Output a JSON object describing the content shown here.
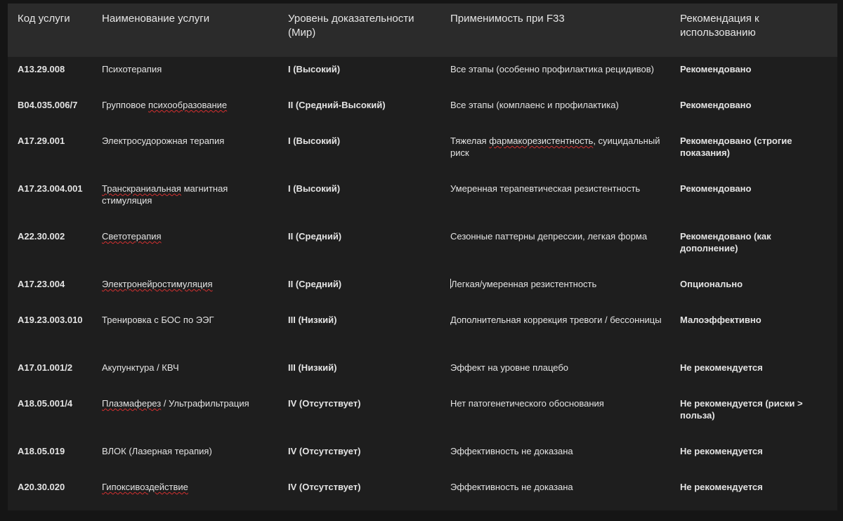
{
  "headers": {
    "code": "Код услуги",
    "name": "Наименование услуги",
    "evidence": "Уровень доказательности (Мир)",
    "applicability": "Применимость при F33",
    "recommendation": "Рекомендация к использованию"
  },
  "rows": [
    {
      "code": "A13.29.008",
      "name_pre": "",
      "name_err": "",
      "name_post": "Психотерапия",
      "evidence": "I (Высокий)",
      "app_pre": "Все этапы (особенно профилактика рецидивов)",
      "app_err": "",
      "app_post": "",
      "rec": "Рекомендовано"
    },
    {
      "code": "B04.035.006/7",
      "name_pre": "Групповое ",
      "name_err": "психообразование",
      "name_post": "",
      "evidence": "II (Средний-Высокий)",
      "app_pre": "Все этапы (комплаенс и профилактика)",
      "app_err": "",
      "app_post": "",
      "rec": "Рекомендовано"
    },
    {
      "code": "A17.29.001",
      "name_pre": "Электросудорожная терапия",
      "name_err": "",
      "name_post": "",
      "evidence": "I (Высокий)",
      "app_pre": "Тяжелая ",
      "app_err": "фармакорезистентность",
      "app_post": ", суицидальный риск",
      "rec": "Рекомендовано (строгие показания)"
    },
    {
      "code": "A17.23.004.001",
      "name_pre": "",
      "name_err": "Транскраниальная",
      "name_post": " магнитная стимуляция",
      "evidence": "I (Высокий)",
      "app_pre": "Умеренная терапевтическая резистентность",
      "app_err": "",
      "app_post": "",
      "rec": "Рекомендовано"
    },
    {
      "code": "A22.30.002",
      "name_pre": "",
      "name_err": "Светотерапия",
      "name_post": "",
      "evidence": "II (Средний)",
      "app_pre": "Сезонные паттерны депрессии, легкая форма",
      "app_err": "",
      "app_post": "",
      "rec": "Рекомендовано (как дополнение)"
    },
    {
      "code": "A17.23.004",
      "name_pre": "",
      "name_err": "Электронейростимуляция",
      "name_post": "",
      "evidence": "II (Средний)",
      "app_pre": "Легкая/умеренная резистентность",
      "app_err": "",
      "app_post": "",
      "rec": "Опционально"
    },
    {
      "code": "A19.23.003.010",
      "name_pre": "Тренировка с БОС по ЭЭГ",
      "name_err": "",
      "name_post": "",
      "evidence": "III (Низкий)",
      "app_pre": "Дополнительная коррекция тревоги / бессонницы",
      "app_err": "",
      "app_post": "",
      "rec": "Малоэффективно"
    },
    {
      "code": "A17.01.001/2",
      "name_pre": "Акупунктура / КВЧ",
      "name_err": "",
      "name_post": "",
      "evidence": "III (Низкий)",
      "app_pre": "Эффект на уровне плацебо",
      "app_err": "",
      "app_post": "",
      "rec": "Не рекомендуется"
    },
    {
      "code": "A18.05.001/4",
      "name_pre": "",
      "name_err": "Плазмаферез",
      "name_post": " / Ультрафильтрация",
      "evidence": "IV (Отсутствует)",
      "app_pre": "Нет патогенетического обоснования",
      "app_err": "",
      "app_post": "",
      "rec": "Не рекомендуется (риски > польза)"
    },
    {
      "code": "A18.05.019",
      "name_pre": "ВЛОК (Лазерная терапия)",
      "name_err": "",
      "name_post": "",
      "evidence": "IV (Отсутствует)",
      "app_pre": "Эффективность не доказана",
      "app_err": "",
      "app_post": "",
      "rec": "Не рекомендуется"
    },
    {
      "code": "A20.30.020",
      "name_pre": "",
      "name_err": "Гипоксивоздействие",
      "name_post": "",
      "evidence": "IV (Отсутствует)",
      "app_pre": "Эффективность не доказана",
      "app_err": "",
      "app_post": "",
      "rec": "Не рекомендуется"
    }
  ]
}
